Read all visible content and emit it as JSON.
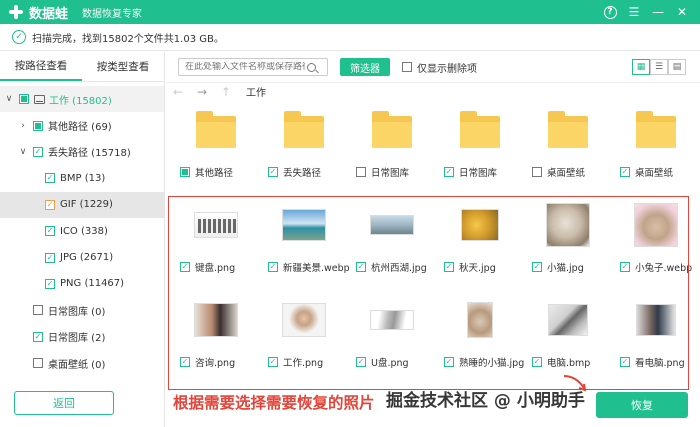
{
  "titlebar": {
    "app_name": "数据蛙",
    "subtitle": "数据恢复专家",
    "help": "?",
    "menu": "☰",
    "minimize": "—",
    "close": "✕"
  },
  "status": {
    "text": "扫描完成，找到15802个文件共1.03 GB。"
  },
  "tabs": [
    {
      "label": "按路径查看",
      "active": true
    },
    {
      "label": "按类型查看",
      "active": false
    }
  ],
  "tree": [
    {
      "label": "工作 (15802)",
      "arrow": "∨",
      "level": 0,
      "check": "partial",
      "icon": "drive"
    },
    {
      "label": "其他路径 (69)",
      "arrow": "›",
      "level": 1,
      "check": "partial"
    },
    {
      "label": "丢失路径 (15718)",
      "arrow": "∨",
      "level": 1,
      "check": "checked"
    },
    {
      "label": "BMP (13)",
      "level": 2,
      "check": "checked"
    },
    {
      "label": "GIF (1229)",
      "level": 2,
      "check": "orange",
      "selected": true
    },
    {
      "label": "ICO (338)",
      "level": 2,
      "check": "checked"
    },
    {
      "label": "JPG (2671)",
      "level": 2,
      "check": "checked"
    },
    {
      "label": "PNG (11467)",
      "level": 2,
      "check": "checked"
    },
    {
      "label": "日常图库 (0)",
      "level": 1,
      "check": "none"
    },
    {
      "label": "日常图库 (2)",
      "level": 1,
      "check": "checked"
    },
    {
      "label": "桌面壁纸 (0)",
      "level": 1,
      "check": "none"
    }
  ],
  "back_button": "返回",
  "toolbar": {
    "search_placeholder": "在此处输入文件名称或保存路径",
    "filter_label": "筛选器",
    "only_deleted": "仅显示删除项"
  },
  "breadcrumb": {
    "back": "←",
    "forward": "→",
    "up": "↑",
    "path": "工作"
  },
  "folders": [
    "其他路径",
    "丢失路径",
    "日常图库",
    "日常图库",
    "桌面壁纸",
    "桌面壁纸"
  ],
  "folder_checks": [
    "partial",
    "checked",
    "none",
    "checked",
    "none",
    "checked"
  ],
  "files_row1": [
    "键盘.png",
    "新疆美景.webp",
    "杭州西湖.jpg",
    "秋天.jpg",
    "小猫.jpg",
    "小兔子.webp"
  ],
  "files_row2": [
    "咨询.png",
    "工作.png",
    "U盘.png",
    "熟睡的小猫.jpg",
    "电脑.bmp",
    "看电脑.png"
  ],
  "annotation": "根据需要选择需要恢复的照片",
  "recover_button": "恢复",
  "watermark": "掘金技术社区 @ 小明助手",
  "colors": {
    "accent": "#1fbf8f",
    "annotation": "#e2453a",
    "folder": "#f7c851"
  }
}
